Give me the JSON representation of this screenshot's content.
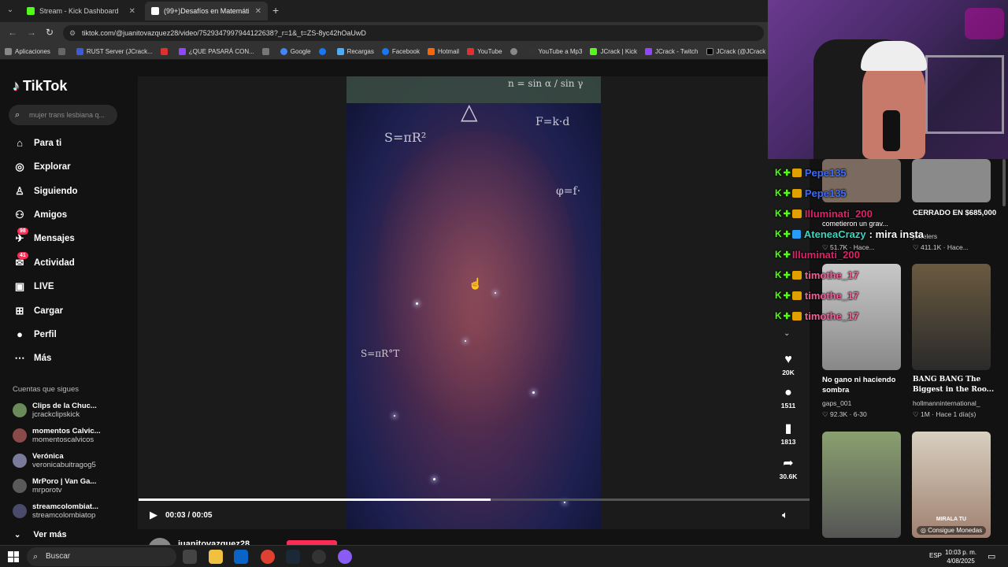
{
  "browser": {
    "tabs": [
      {
        "label": "Stream - Kick Dashboard",
        "active": false
      },
      {
        "label": "(99+)Desafíos en Matemáticas",
        "active": true
      }
    ],
    "url": "tiktok.com/@juanitovazquez28/video/7529347997944122638?_r=1&_t=ZS-8yc42hOaUwD",
    "bookmarks": [
      "Aplicaciones",
      "RUST Server (JCrack...",
      "¿QUE PASARÁ CON...",
      "Google",
      "Recargas",
      "Facebook",
      "Hotmail",
      "YouTube",
      "YouTube a Mp3",
      "JCrack | Kick",
      "JCrack - Twitch",
      "JCrack (@JCrack"
    ]
  },
  "tiktok": {
    "logo": "TikTok",
    "search_placeholder": "mujer trans lesbiana q...",
    "nav": [
      {
        "label": "Para ti",
        "icon": "home-icon",
        "badge": ""
      },
      {
        "label": "Explorar",
        "icon": "compass-icon",
        "badge": ""
      },
      {
        "label": "Siguiendo",
        "icon": "following-icon",
        "badge": ""
      },
      {
        "label": "Amigos",
        "icon": "friends-icon",
        "badge": ""
      },
      {
        "label": "Mensajes",
        "icon": "messages-icon",
        "badge": "98"
      },
      {
        "label": "Actividad",
        "icon": "activity-icon",
        "badge": "41"
      },
      {
        "label": "LIVE",
        "icon": "live-icon",
        "badge": ""
      },
      {
        "label": "Cargar",
        "icon": "upload-icon",
        "badge": ""
      },
      {
        "label": "Perfil",
        "icon": "profile-icon",
        "badge": ""
      },
      {
        "label": "Más",
        "icon": "more-icon",
        "badge": ""
      }
    ],
    "following_title": "Cuentas que sigues",
    "following": [
      {
        "name": "Clips de la Chuc...",
        "handle": "jcrackclipskick"
      },
      {
        "name": "momentos Calvic...",
        "handle": "momentoscalvicos"
      },
      {
        "name": "Verónica",
        "handle": "veronicabuitragog5"
      },
      {
        "name": "MrPoro | Van Ga...",
        "handle": "mrporotv"
      },
      {
        "name": "streamcolombiat...",
        "handle": "streamcolombiatop"
      }
    ],
    "see_more": "Ver más",
    "player": {
      "time": "00:03 / 00:05",
      "progress": 0.525,
      "formulas": [
        "n = sin α / sin γ",
        "S=πR²",
        "F=k·d",
        "φ=f·",
        "S=πR°T"
      ]
    },
    "author": "juanitovazquez28",
    "actions": {
      "likes": "20K",
      "comments": "1511",
      "saves": "1813",
      "shares": "30.6K"
    },
    "recommended": [
      {
        "title": "",
        "meta": "",
        "stats": "51.7K · Hace..."
      },
      {
        "title": "CERRADO EN $685,000",
        "meta": "jewelers",
        "stats": "411.1K · Hace..."
      },
      {
        "title": "No gano ni haciendo sombra",
        "meta": "gaps_001",
        "stats": "92.3K · 6-30"
      },
      {
        "title": "BANG BANG The Biggest in the Roo...",
        "meta": "hollmanninternational_",
        "stats": "1M · Hace 1 día(s)"
      },
      {
        "title": "",
        "meta": "",
        "stats": ""
      },
      {
        "title": "",
        "meta": "",
        "stats": "",
        "thumb_label": "MIRALA TU",
        "coin": "Consigue Monedas"
      }
    ],
    "rec_sub": "cometieron un grav..."
  },
  "chat": [
    {
      "user": "Pepe135",
      "color": "#3b6cff",
      "msg": "",
      "badge": "crown"
    },
    {
      "user": "Pepe135",
      "color": "#3b6cff",
      "msg": "",
      "badge": "crown"
    },
    {
      "user": "Illuminati_200",
      "color": "#e0206a",
      "msg": "",
      "badge": "crown"
    },
    {
      "user": "AteneaCrazy",
      "color": "#3ad6c0",
      "msg": ": mira insta",
      "badge": "cube"
    },
    {
      "user": "Illuminati_200",
      "color": "#e0206a",
      "msg": "",
      "badge": "none"
    },
    {
      "user": "timothe_17",
      "color": "#ff5a9a",
      "msg": "",
      "badge": "crown"
    },
    {
      "user": "timothe_17",
      "color": "#ff5a9a",
      "msg": "",
      "badge": "crown"
    },
    {
      "user": "timothe_17",
      "color": "#ff5a9a",
      "msg": "",
      "badge": "crown"
    }
  ],
  "taskbar": {
    "search": "Buscar",
    "lang": "ESP",
    "time": "10:03 p. m.",
    "date": "4/08/2025"
  },
  "colors": {
    "tiktok_red": "#fe2c55",
    "kick_green": "#53fc18",
    "bg": "#121212"
  }
}
